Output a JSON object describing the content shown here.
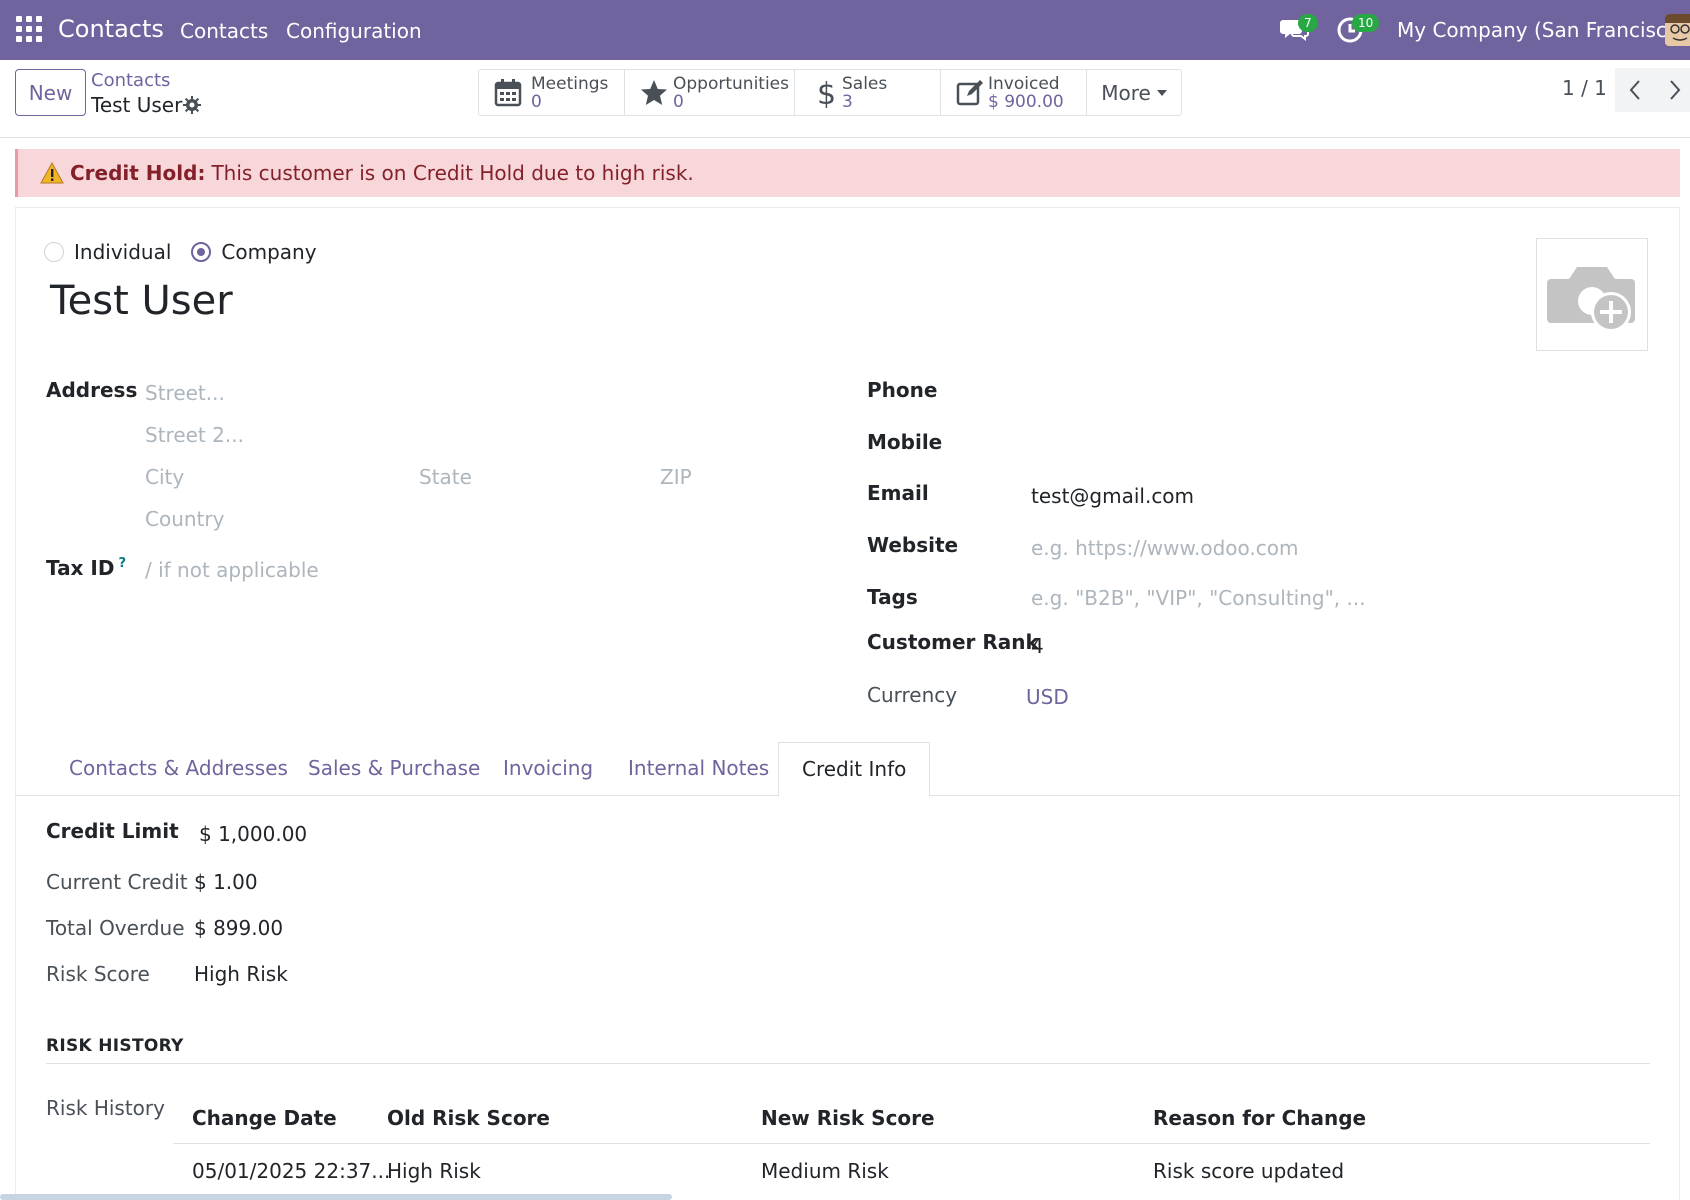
{
  "navbar": {
    "brand": "Contacts",
    "menu": [
      "Contacts",
      "Configuration"
    ],
    "messages_count": "7",
    "activities_count": "10",
    "company": "My Company (San Francisco)"
  },
  "control_panel": {
    "new_label": "New",
    "breadcrumb_parent": "Contacts",
    "breadcrumb_current": "Test User",
    "stats": [
      {
        "label": "Meetings",
        "value": "0",
        "icon": "calendar-icon"
      },
      {
        "label": "Opportunities",
        "value": "0",
        "icon": "star-icon"
      },
      {
        "label": "Sales",
        "value": "3",
        "icon": "dollar-icon"
      },
      {
        "label": "Invoiced",
        "value": "$ 900.00",
        "icon": "edit-icon"
      }
    ],
    "more_label": "More",
    "pager": "1 / 1"
  },
  "alert": {
    "title": "Credit Hold:",
    "message": "This customer is on Credit Hold due to high risk."
  },
  "form": {
    "type_options": [
      "Individual",
      "Company"
    ],
    "selected_type": "Company",
    "name": "Test User",
    "address_label": "Address",
    "street_placeholder": "Street...",
    "street2_placeholder": "Street 2...",
    "city_placeholder": "City",
    "state_placeholder": "State",
    "zip_placeholder": "ZIP",
    "country_placeholder": "Country",
    "tax_id_label": "Tax ID",
    "tax_id_help": "?",
    "tax_id_placeholder": "/ if not applicable",
    "phone_label": "Phone",
    "mobile_label": "Mobile",
    "email_label": "Email",
    "email_value": "test@gmail.com",
    "website_label": "Website",
    "website_placeholder": "e.g. https://www.odoo.com",
    "tags_label": "Tags",
    "tags_placeholder": "e.g. \"B2B\", \"VIP\", \"Consulting\", ...",
    "customer_rank_label": "Customer Rank",
    "customer_rank_value": "4",
    "currency_label": "Currency",
    "currency_value": "USD"
  },
  "tabs": [
    "Contacts & Addresses",
    "Sales & Purchase",
    "Invoicing",
    "Internal Notes",
    "Credit Info"
  ],
  "active_tab": "Credit Info",
  "credit_info": {
    "credit_limit_label": "Credit Limit",
    "credit_limit_value": "$ 1,000.00",
    "current_credit_label": "Current Credit",
    "current_credit_value": "$ 1.00",
    "total_overdue_label": "Total Overdue",
    "total_overdue_value": "$ 899.00",
    "risk_score_label": "Risk Score",
    "risk_score_value": "High Risk",
    "risk_history_section": "RISK HISTORY",
    "risk_history_label": "Risk History",
    "columns": [
      "Change Date",
      "Old Risk Score",
      "New Risk Score",
      "Reason for Change"
    ],
    "rows": [
      [
        "05/01/2025 22:37...",
        "High Risk",
        "Medium Risk",
        "Risk score updated"
      ]
    ]
  },
  "colors": {
    "brand": "#71639e",
    "alert_bg": "#f8d7da",
    "alert_text": "#842029",
    "badge": "#28a745"
  }
}
